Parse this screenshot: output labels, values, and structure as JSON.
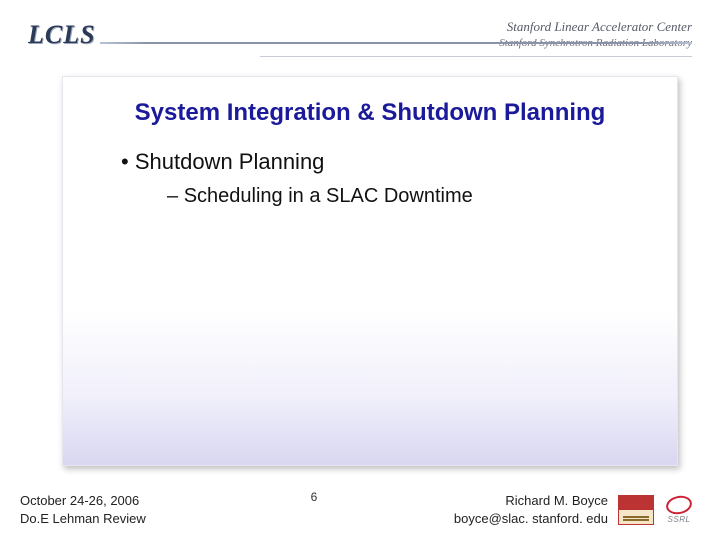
{
  "header": {
    "logo_text": "LCLS",
    "lab_line1": "Stanford Linear Accelerator Center",
    "lab_line2": "Stanford Synchrotron Radiation Laboratory"
  },
  "slide": {
    "title": "System Integration & Shutdown Planning",
    "bullet1": "Shutdown Planning",
    "bullet2": "Scheduling in a SLAC Downtime"
  },
  "footer": {
    "date": "October 24-26, 2006",
    "review": "Do.E Lehman Review",
    "page": "6",
    "author": "Richard M. Boyce",
    "email": "boyce@slac. stanford. edu",
    "ssrl_label": "SSRL"
  }
}
